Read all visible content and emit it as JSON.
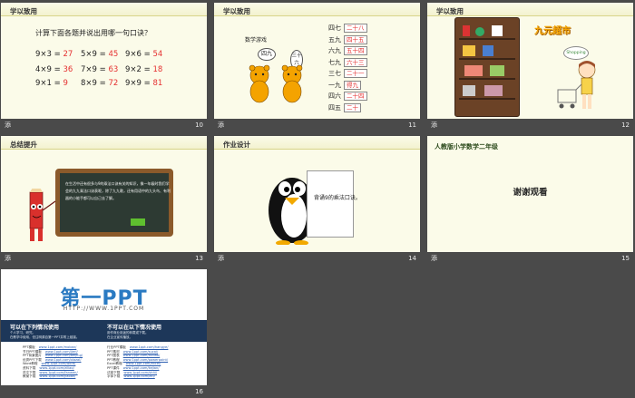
{
  "slides": [
    {
      "number": "10",
      "title": "学以致用",
      "question": "计算下面各题并说出用哪一句口诀？",
      "rows": [
        [
          {
            "expr": "9×3 =",
            "ans": "27"
          },
          {
            "expr": "5×9 =",
            "ans": "45"
          },
          {
            "expr": "9×6 =",
            "ans": "54"
          }
        ],
        [
          {
            "expr": "4×9 =",
            "ans": "36"
          },
          {
            "expr": "7×9 =",
            "ans": "63"
          },
          {
            "expr": "9×2 =",
            "ans": "18"
          }
        ],
        [
          {
            "expr": "9×1 =",
            "ans": "9"
          },
          {
            "expr": "8×9 =",
            "ans": "72"
          },
          {
            "expr": "9×9 =",
            "ans": "81"
          }
        ]
      ]
    },
    {
      "number": "11",
      "title": "学以致用",
      "game_label": "数学游戏",
      "bubble_left": "四九",
      "bubble_right": "三十六",
      "kou_jue": [
        {
          "lead": "四七",
          "box": "二十八"
        },
        {
          "lead": "五九",
          "box": "四十五"
        },
        {
          "lead": "六九",
          "box": "五十四"
        },
        {
          "lead": "七九",
          "box": "六十三"
        },
        {
          "lead": "三七",
          "box": "二十一"
        },
        {
          "lead": "一九",
          "box": "得九"
        },
        {
          "lead": "四六",
          "box": "二十四"
        },
        {
          "lead": "四五",
          "box": "二十"
        }
      ]
    },
    {
      "number": "12",
      "title": "学以致用",
      "shop_title": "九元超市",
      "bubble": "Shopping"
    },
    {
      "number": "13",
      "title": "总结提升",
      "board_text": "在生活中还有很多与9的乘法口诀有关的知识，像一年级时我们学会的九九乘法口诀表呢，除了九九歌，还有用语中的九头鸟、有利器的小能手都可以自己去了解。"
    },
    {
      "number": "14",
      "title": "作业设计",
      "homework": "背诵9的乘法口诀。"
    },
    {
      "number": "15",
      "title": "人教版小学数学二年级",
      "thanks": "谢谢观看"
    },
    {
      "number": "16",
      "logo": "第一PPT",
      "url": "HTTP://WWW.1PPT.COM",
      "can_title": "可以在下列情况使用",
      "cannot_title": "不可以在以下情况使用",
      "can_sub": [
        "个人学习、研究。",
        "在教学中使用，但注明源自第一PPT并附上链接。"
      ],
      "cannot_sub": [
        "用作商业用途的转载或下载。",
        "在企业宣传播放。"
      ],
      "left_links": [
        {
          "label": "PPT模板",
          "url": "www.1ppt.com/moban/"
        },
        {
          "label": "节日PPT模板",
          "url": "www.1ppt.com/jieri/"
        },
        {
          "label": "PPT背景图片",
          "url": "www.1ppt.com/beijing/"
        },
        {
          "label": "优秀PPT下载",
          "url": "www.1ppt.com/xiazai/"
        },
        {
          "label": "Word教程",
          "url": "www.1ppt.com/word/"
        },
        {
          "label": "资料下载",
          "url": "www.1ppt.com/ziliao/"
        },
        {
          "label": "范文下载",
          "url": "www.1ppt.com/fanwen/"
        },
        {
          "label": "教案下载",
          "url": "www.1ppt.com/jiaoan/"
        }
      ],
      "right_links": [
        {
          "label": "行业PPT模板",
          "url": "www.1ppt.com/hangye/"
        },
        {
          "label": "PPT素材",
          "url": "www.1ppt.com/sucai/"
        },
        {
          "label": "PPT图表",
          "url": "www.1ppt.com/tubiao/"
        },
        {
          "label": "PPT教程",
          "url": "www.1ppt.com/powerpoint/"
        },
        {
          "label": "Excel教程",
          "url": "www.1ppt.com/excel/"
        },
        {
          "label": "PPT课件",
          "url": "www.1ppt.com/kejian/"
        },
        {
          "label": "试卷下载",
          "url": "www.1ppt.com/shiti/"
        },
        {
          "label": "字体下载",
          "url": "www.1ppt.com/ziti/"
        }
      ]
    }
  ],
  "footer_link_text": "添"
}
